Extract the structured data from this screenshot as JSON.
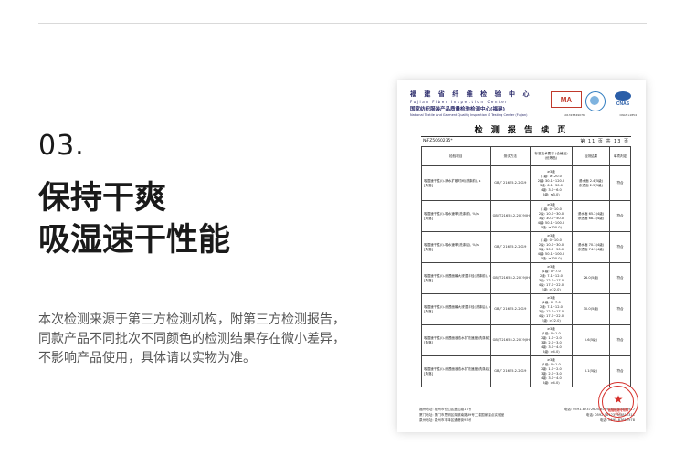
{
  "page": {
    "section_number": "03.",
    "headline": [
      "保持干爽",
      "吸湿速干性能"
    ],
    "description": [
      "本次检测来源于第三方检测机构，附第三方检测报告，",
      "同款产品不同批次不同颜色的检测结果存在微小差异，",
      "不影响产品使用，具体请以实物为准。"
    ]
  },
  "report": {
    "org_name_cn": "福 建 省 纤 维 检 验 中 心",
    "org_name_en": "Fujian Fiber Inspection Center",
    "org_name_cn2": "国家纺织服装产品质量检验检测中心(福建)",
    "org_name_en2": "National Textile And Garment Quality Inspection & Testing Center (Fujian)",
    "logo_ma": "MA",
    "logo_cnas": "CNAS",
    "cert_codes": [
      "191315349076",
      "",
      "CNAS L1854"
    ],
    "title": "检 测 报 告 续 页",
    "report_no": "№FZ5060235*",
    "page_info": "第 11 页 共 13 页",
    "columns": [
      "检验项目",
      "测试方法",
      "标准技术要求 (合格品)(优等品)",
      "检测结果",
      "单项判定"
    ],
    "rows": [
      {
        "item": [
          "吸湿速干性(I)-滴水扩散时间(洗涤前), s",
          "[角落]"
        ],
        "method": [
          "GB/T 21655.2-2019"
        ],
        "requirement": [
          "≥3级",
          "(1级: ≥120.0",
          "2级: 30.1~120.0",
          "3级: 6.1~30.0",
          "4级: 3.1~6.0",
          "5级: ≤3.0)"
        ],
        "result": [
          "浸水面 2.4(5级)",
          "渗透面 2.5(5级)"
        ],
        "verdict": "符合"
      },
      {
        "item": [
          "吸湿速干性(I)-吸水速率(洗涤前), %/s",
          "[角落]"
        ],
        "method": [
          "GB/T 21655.2-2019(IHOB/T 9629-2017中W×5次, 悬挂晾干)"
        ],
        "requirement": [
          "≥3级",
          "(1级: 0~10.0",
          "2级: 10.1~30.0",
          "3级: 30.1~50.0",
          "4级: 50.1~100.0",
          "5级: ≥100.0)"
        ],
        "result": [
          "浸水面 65.2(4级)",
          "渗透面 68.3(4级)"
        ],
        "verdict": "符合"
      },
      {
        "item": [
          "吸湿速干性(I)-吸水速率(洗涤后), %/s",
          "[角落]"
        ],
        "method": [
          "GB/T 21655.2-2019"
        ],
        "requirement": [
          "≥3级",
          "(1级: 0~10.0",
          "2级: 10.1~30.0",
          "3级: 30.1~50.0",
          "4级: 50.1~100.0",
          "5级: ≥100.0)"
        ],
        "result": [
          "浸水面 70.3(4级)",
          "渗透面 74.5(4级)"
        ],
        "verdict": "符合"
      },
      {
        "item": [
          "吸湿速干性(I)-渗透面最大浸湿半径(洗涤前), mm",
          "[角落]"
        ],
        "method": [
          "GB/T 21655.2-2019(IHOB/T 9629-2017中W×5次, 悬挂晾干)"
        ],
        "requirement": [
          "≥3级",
          "(1级: 0~7.0",
          "2级: 7.1~12.0",
          "3级: 12.1~17.0",
          "4级: 17.1~22.0",
          "5级: >22.0)"
        ],
        "result": [
          "26.0(5级)"
        ],
        "verdict": "符合"
      },
      {
        "item": [
          "吸湿速干性(I)-渗透面最大浸湿半径(洗涤后), mm",
          "[角落]"
        ],
        "method": [
          "GB/T 21655.2-2019"
        ],
        "requirement": [
          "≥3级",
          "(1级: 0~7.0",
          "2级: 7.1~12.0",
          "3级: 12.1~17.0",
          "4级: 17.1~22.0",
          "5级: >22.0)"
        ],
        "result": [
          "30.0(5级)"
        ],
        "verdict": "符合"
      },
      {
        "item": [
          "吸湿速干性(I)-渗透面液态水扩散速度(洗涤前), mm/s",
          "[角落]"
        ],
        "method": [
          "GB/T 21655.2-2019(IHOB/T 9629-2017中W×5次, 悬挂晾干)"
        ],
        "requirement": [
          "≥3级",
          "(1级: 0~1.0",
          "2级: 1.1~2.0",
          "3级: 2.1~3.0",
          "4级: 3.1~4.0",
          "5级: >4.0)"
        ],
        "result": [
          "5.6(5级)"
        ],
        "verdict": "符合"
      },
      {
        "item": [
          "吸湿速干性(I)-渗透面液态水扩散速度(洗涤后), mm/s",
          "[角落]"
        ],
        "method": [
          "GB/T 21655.2-2019"
        ],
        "requirement": [
          "≥3级",
          "(1级: 0~1.0",
          "2级: 1.1~2.0",
          "3级: 2.1~3.0",
          "4级: 3.1~4.0",
          "5级: >4.0)"
        ],
        "result": [
          "6.1(5级)"
        ],
        "verdict": "符合"
      }
    ],
    "footer": [
      [
        "福州地址: 福州市仓山区盖山路17号",
        "电话: 0591-87372605/87897659/87897917"
      ],
      [
        "厦门地址: 厦门市思明区湖滨南路89号二楼国家重点实验室",
        "电话: 0592-5812376/5812311"
      ],
      [
        "泉州地址: 泉州市丰泽区通港街93号",
        "电话: 0595-87652978"
      ]
    ],
    "seal": {
      "label": "检验检测专用章",
      "number": "(92)"
    }
  }
}
